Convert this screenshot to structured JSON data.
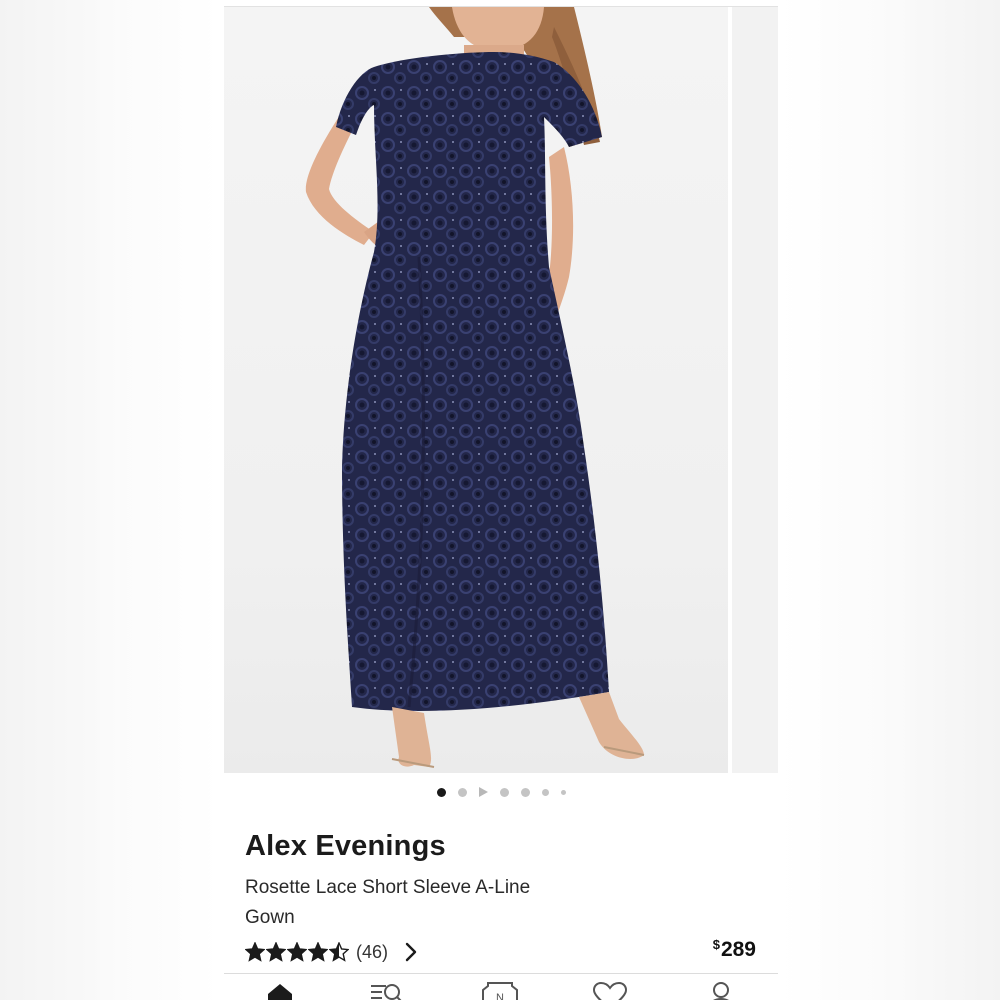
{
  "product": {
    "brand": "Alex Evenings",
    "name": "Rosette Lace Short Sleeve A-Line Gown",
    "rating": 4.5,
    "review_count": "(46)",
    "price_currency": "$",
    "price_value": "289"
  },
  "gallery": {
    "total_dots": 7,
    "active_index": 0,
    "video_dot_index": 2
  },
  "colors": {
    "gown": "#262a4a",
    "text": "#1b1b1b",
    "active_dot": "#1a1a1a",
    "inactive_dot": "#c4c4c4"
  },
  "tabbar": {
    "tabs": [
      "home-icon",
      "search-filter-icon",
      "nordstrom-n-icon",
      "heart-icon",
      "account-icon"
    ],
    "active": "home-icon"
  }
}
